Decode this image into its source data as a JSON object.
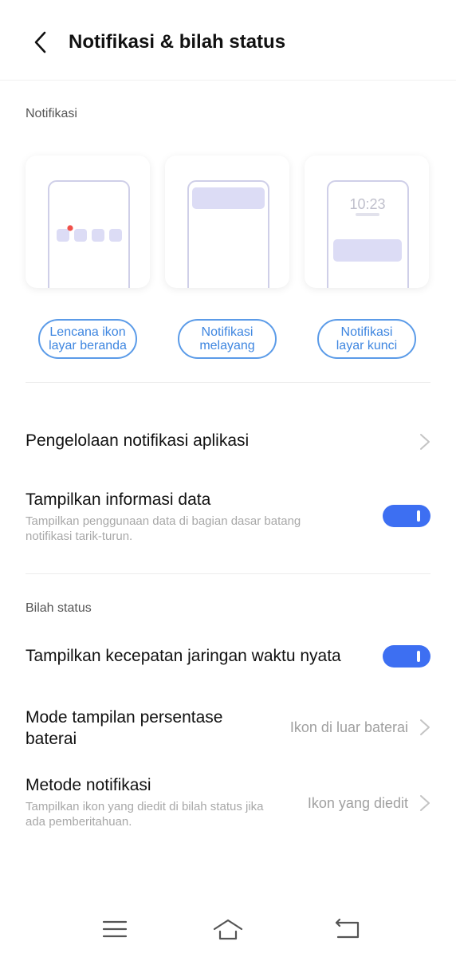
{
  "header": {
    "title": "Notifikasi & bilah status"
  },
  "notifications_section": {
    "label": "Notifikasi",
    "preview_time": "10:23",
    "options": [
      {
        "line1": "Lencana ikon",
        "line2": "layar beranda"
      },
      {
        "line1": "Notifikasi",
        "line2": "melayang"
      },
      {
        "line1": "Notifikasi",
        "line2": "layar kunci"
      }
    ]
  },
  "rows": {
    "app_notifications": {
      "title": "Pengelolaan notifikasi aplikasi"
    },
    "data_info": {
      "title": "Tampilkan informasi data",
      "subtitle_line1": "Tampilkan penggunaan data di bagian dasar batang",
      "subtitle_line2": "notifikasi tarik-turun.",
      "enabled": true
    }
  },
  "status_bar_section": {
    "label": "Bilah status",
    "network_speed": {
      "title": "Tampilkan kecepatan jaringan waktu nyata",
      "enabled": true
    },
    "battery_mode": {
      "title_line1": "Mode tampilan persentase",
      "title_line2": "baterai",
      "value": "Ikon di luar baterai"
    },
    "notification_method": {
      "title": "Metode notifikasi",
      "subtitle_line1": "Tampilkan ikon yang diedit di bilah status jika",
      "subtitle_line2": "ada pemberitahuan.",
      "value": "Ikon yang diedit"
    }
  },
  "colors": {
    "accent": "#3d6ff2",
    "pill_border": "#5b9be8",
    "pill_text": "#3e86e0",
    "preview_block": "#dcdcf5",
    "badge_dot": "#f0504a"
  },
  "icons": [
    "back-arrow-icon",
    "chevron-right-icon",
    "menu-icon",
    "home-icon",
    "return-icon"
  ]
}
